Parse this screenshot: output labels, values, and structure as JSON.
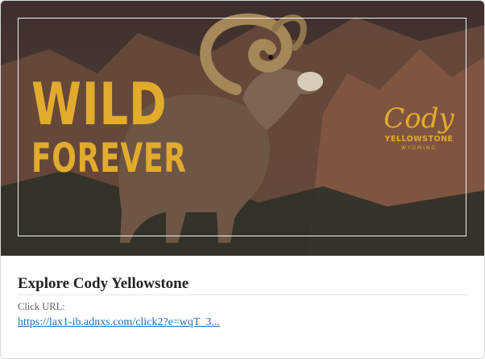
{
  "ad": {
    "banner": {
      "headline_line1": "WILD",
      "headline_line2": "FOREVER",
      "brand_name": "Cody",
      "brand_sub": "YELLOWSTONE",
      "brand_region": "WYOMING",
      "image_subject": "bighorn-sheep-ram",
      "colors": {
        "accent": "#e3ab2c",
        "frame": "#f2f2f2"
      }
    },
    "title": "Explore Cody Yellowstone",
    "click_url_label": "Click URL:",
    "click_url_text": "https://lax1-ib.adnxs.com/click2?e=wqT_3...",
    "colors": {
      "link": "#1f6fb5",
      "title": "#222222"
    }
  }
}
